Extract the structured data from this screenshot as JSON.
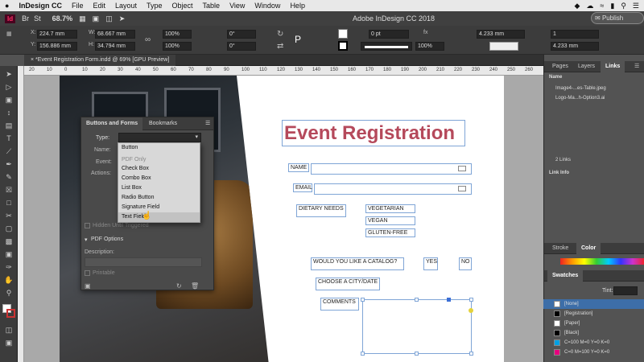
{
  "menubar": {
    "apple": "",
    "app": "InDesign CC",
    "items": [
      "File",
      "Edit",
      "Layout",
      "Type",
      "Object",
      "Table",
      "View",
      "Window",
      "Help"
    ]
  },
  "appbar": {
    "logo": "Id",
    "zoom": "68.7%",
    "title": "Adobe InDesign CC 2018",
    "publish": "Publish Online"
  },
  "control": {
    "x": "224.7 mm",
    "y": "156.886 mm",
    "w": "68.667 mm",
    "h": "34.794 mm",
    "scale_x": "100%",
    "scale_y": "100%",
    "angle": "0°",
    "shear": "0°",
    "stroke": "0 pt",
    "opacity": "100%",
    "fit_w": "4.233 mm",
    "fit_h": "4.233 mm",
    "cols": "1"
  },
  "doc_tab": {
    "close": "×",
    "label": "*Event Registration Form.indd @ 69% [GPU Preview]"
  },
  "ruler": {
    "h_ticks": [
      "20",
      "10",
      "0",
      "10",
      "20",
      "30",
      "40",
      "50",
      "60",
      "70",
      "80",
      "90",
      "100",
      "110",
      "120",
      "130",
      "140",
      "150",
      "160",
      "170",
      "180",
      "190",
      "200",
      "210",
      "220",
      "230",
      "240",
      "250",
      "260"
    ]
  },
  "form": {
    "title": "Event Registration",
    "name": "NAME",
    "email": "EMAIL",
    "dietary": "DIETARY NEEDS",
    "options": [
      "VEGETARIAN",
      "VEGAN",
      "GLUTEN-FREE"
    ],
    "catalog": "WOULD YOU LIKE A CATALOG?",
    "yes": "YES",
    "no": "NO",
    "city": "CHOOSE A CITY/DATE",
    "comments": "COMMENTS"
  },
  "bf_panel": {
    "tab_active": "Buttons and Forms",
    "tab_other": "Bookmarks",
    "type_label": "Type:",
    "name_label": "Name:",
    "event_label": "Event:",
    "actions_label": "Actions:",
    "hidden_label": "Hidden Until Triggered",
    "pdf_options": "PDF Options",
    "description": "Description:",
    "printable": "Printable",
    "dropdown": [
      {
        "label": "Button",
        "state": "normal"
      },
      {
        "label": "PDF Only",
        "state": "disabled"
      },
      {
        "label": "Check Box",
        "state": "normal"
      },
      {
        "label": "Combo Box",
        "state": "normal"
      },
      {
        "label": "List Box",
        "state": "normal"
      },
      {
        "label": "Radio Button",
        "state": "normal"
      },
      {
        "label": "Signature Field",
        "state": "normal"
      },
      {
        "label": "Text Field",
        "state": "selected"
      }
    ]
  },
  "right_panel": {
    "tabs": [
      "Pages",
      "Layers",
      "Links"
    ],
    "name_col": "Name",
    "links": [
      "Image4-...es-Table.jpeg",
      "Logo-Ma...h-Option3.ai"
    ],
    "links_count": "2 Links",
    "link_info": "Link Info",
    "stroke_tab": "Stroke",
    "color_tab": "Color",
    "swatches_tab": "Swatches",
    "tint": "Tint:",
    "tint_val": "",
    "swatches": [
      {
        "name": "[None]",
        "color": "#ffffff",
        "selected": true
      },
      {
        "name": "[Registration]",
        "color": "#000000",
        "selected": false
      },
      {
        "name": "[Paper]",
        "color": "#ffffff",
        "selected": false
      },
      {
        "name": "[Black]",
        "color": "#000000",
        "selected": false
      },
      {
        "name": "C=100 M=0 Y=0 K=0",
        "color": "#00a0e3",
        "selected": false
      },
      {
        "name": "C=0 M=100 Y=0 K=0",
        "color": "#e6007e",
        "selected": false
      }
    ]
  },
  "colors": {
    "accent": "#b5495b",
    "frame": "#7fa5d6"
  }
}
